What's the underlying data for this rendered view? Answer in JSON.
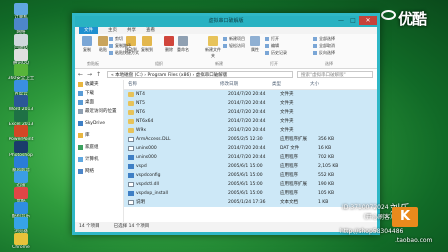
{
  "desktop": {
    "icons": [
      {
        "label": "计算机",
        "color": "#5fa7e0"
      },
      {
        "label": "网络",
        "color": "#4d86c9"
      },
      {
        "label": "回收站",
        "color": "#cfd8dc"
      },
      {
        "label": "腾讯QQ",
        "color": "#e0e0e0"
      },
      {
        "label": "360安全卫士",
        "color": "#58b43a"
      },
      {
        "label": "百度云",
        "color": "#3a8fe0"
      },
      {
        "label": "Word 2013",
        "color": "#2b5797"
      },
      {
        "label": "Excel 2013",
        "color": "#1e7145"
      },
      {
        "label": "PowerPoint",
        "color": "#d24726"
      },
      {
        "label": "Photoshop",
        "color": "#1a3c6b"
      },
      {
        "label": "暴风影音",
        "color": "#2a7dd8"
      },
      {
        "label": "迅雷",
        "color": "#3b9ee5"
      },
      {
        "label": "优酷",
        "color": "#e04646"
      },
      {
        "label": "酷狗音乐",
        "color": "#2f8ee0"
      },
      {
        "label": "浏览器",
        "color": "#36a3e8"
      },
      {
        "label": "Chrome",
        "color": "#e8c23a"
      }
    ]
  },
  "brand": {
    "text": "优酷"
  },
  "window": {
    "title": "虚拟串口破解版",
    "min": "—",
    "max": "□",
    "close": "✕",
    "tabs": [
      "文件",
      "主页",
      "共享",
      "查看"
    ],
    "ribbon": {
      "buttons": [
        {
          "label": "复制",
          "color": "#7aa6d6"
        },
        {
          "label": "粘贴",
          "color": "#c9a45c"
        },
        {
          "label": "移动到",
          "color": "#e3b74d"
        },
        {
          "label": "复制到",
          "color": "#e3b74d"
        },
        {
          "label": "删除",
          "color": "#d0453b"
        },
        {
          "label": "重命名",
          "color": "#8fa0b2"
        },
        {
          "label": "新建文件夹",
          "color": "#e7c35a"
        },
        {
          "label": "属性",
          "color": "#8fb0d3"
        }
      ],
      "small": [
        "剪切",
        "复制路径",
        "粘贴快捷方式",
        "新建项目",
        "轻松访问",
        "打开",
        "编辑",
        "历史记录",
        "全部选择",
        "全部取消",
        "反向选择"
      ],
      "groups": [
        "剪贴板",
        "组织",
        "新建",
        "打开",
        "选择"
      ]
    },
    "address": {
      "back": "←",
      "forward": "→",
      "up": "↑",
      "path": "« 本地磁盘 (C:) › Program Files (x86) › 虚拟串口破解版",
      "search_placeholder": "搜索\"虚拟串口破解版\""
    },
    "nav": [
      {
        "label": "收藏夹",
        "color": "#e8b640"
      },
      {
        "label": "下载",
        "color": "#5a9bd5"
      },
      {
        "label": "桌面",
        "color": "#5a9bd5"
      },
      {
        "label": "最近访问的位置",
        "color": "#8fa0b2"
      },
      {
        "label": "SkyDrive",
        "color": "#3e7fc5"
      },
      {
        "label": "库",
        "color": "#e8b640"
      },
      {
        "label": "家庭组",
        "color": "#3ba15e"
      },
      {
        "label": "计算机",
        "color": "#5fa7e0"
      },
      {
        "label": "网络",
        "color": "#4d86c9"
      }
    ],
    "columns": [
      "名称",
      "修改日期",
      "类型",
      "大小"
    ],
    "files": [
      {
        "name": "NT4",
        "date": "2014/7/20 20:44",
        "type": "文件夹",
        "size": "",
        "kind": "folder"
      },
      {
        "name": "NT5",
        "date": "2014/7/20 20:44",
        "type": "文件夹",
        "size": "",
        "kind": "folder"
      },
      {
        "name": "NT6",
        "date": "2014/7/20 20:44",
        "type": "文件夹",
        "size": "",
        "kind": "folder"
      },
      {
        "name": "NT6x64",
        "date": "2014/7/20 20:44",
        "type": "文件夹",
        "size": "",
        "kind": "folder"
      },
      {
        "name": "W9x",
        "date": "2014/7/20 20:44",
        "type": "文件夹",
        "size": "",
        "kind": "folder"
      },
      {
        "name": "ArmAccess.DLL",
        "date": "2005/2/5 12:30",
        "type": "应用程序扩展",
        "size": "356 KB",
        "kind": "file"
      },
      {
        "name": "unins000",
        "date": "2014/7/20 20:44",
        "type": "DAT 文件",
        "size": "16 KB",
        "kind": "file"
      },
      {
        "name": "unins000",
        "date": "2014/7/20 20:44",
        "type": "应用程序",
        "size": "702 KB",
        "kind": "app"
      },
      {
        "name": "vspd",
        "date": "2005/6/1 15:00",
        "type": "应用程序",
        "size": "2,105 KB",
        "kind": "app"
      },
      {
        "name": "vspdconfig",
        "date": "2005/6/1 15:00",
        "type": "应用程序",
        "size": "552 KB",
        "kind": "app"
      },
      {
        "name": "vspdctl.dll",
        "date": "2005/6/1 15:00",
        "type": "应用程序扩展",
        "size": "190 KB",
        "kind": "file"
      },
      {
        "name": "vspdxp_install",
        "date": "2005/6/1 15:00",
        "type": "应用程序",
        "size": "105 KB",
        "kind": "app"
      },
      {
        "name": "说明",
        "date": "2005/1/24 17:36",
        "type": "文本文档",
        "size": "1 KB",
        "kind": "file"
      }
    ],
    "status": {
      "count": "14 个项目",
      "selected": "已选择 14 个项目"
    }
  },
  "watermarks": {
    "id_line": "ID:3710072024",
    "shop_line": "http://shop58304486",
    "taobao": ".taobao.com",
    "signature": "刘乐",
    "kbadge": "K",
    "subtitle": "（开心刷客）"
  }
}
